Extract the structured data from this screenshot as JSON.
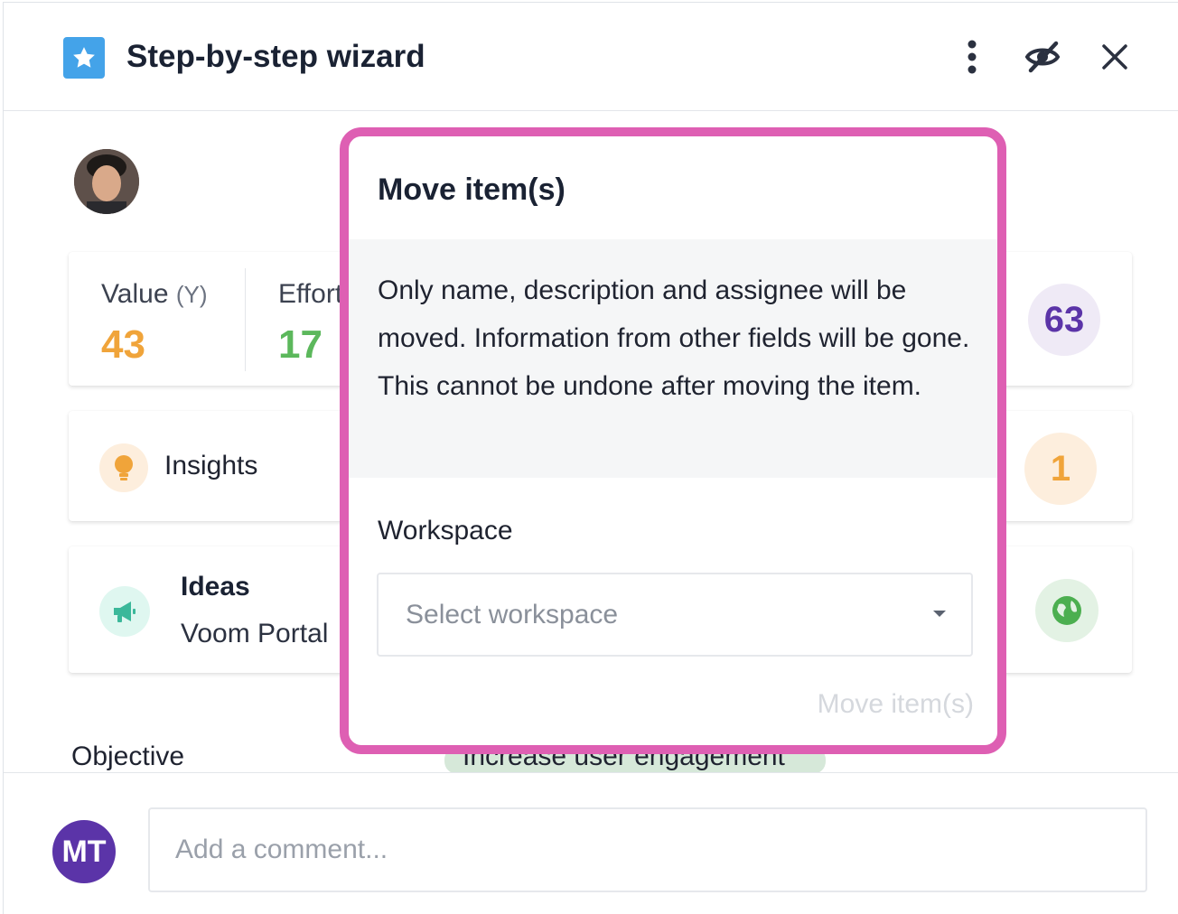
{
  "header": {
    "title": "Step-by-step wizard",
    "icons": [
      "star-icon",
      "more-vertical-icon",
      "eye-off-icon",
      "close-icon"
    ]
  },
  "metrics": {
    "value_label": "Value",
    "value_sub": "(Y)",
    "value_number": "43",
    "effort_label": "Effort",
    "effort_number": "17",
    "score": "63"
  },
  "insights": {
    "label": "Insights",
    "count": "1"
  },
  "ideas": {
    "title": "Ideas",
    "subtitle": "Voom Portal"
  },
  "objective": {
    "label": "Objective",
    "tag": "Increase user engagement"
  },
  "comment": {
    "avatar_initials": "MT",
    "placeholder": "Add a comment..."
  },
  "popup": {
    "title": "Move item(s)",
    "note": "Only name, description and assignee will be moved. Information from other fields will be gone. This cannot be undone after moving the item.",
    "workspace_label": "Workspace",
    "workspace_placeholder": "Select workspace",
    "move_button": "Move item(s)"
  },
  "colors": {
    "popup_border": "#de5fb3",
    "value_orange": "#f0a43a",
    "effort_green": "#5cb85c",
    "score_purple": "#5b34a8",
    "avatar_purple": "#5b34a8",
    "star_blue": "#44a3e9"
  }
}
